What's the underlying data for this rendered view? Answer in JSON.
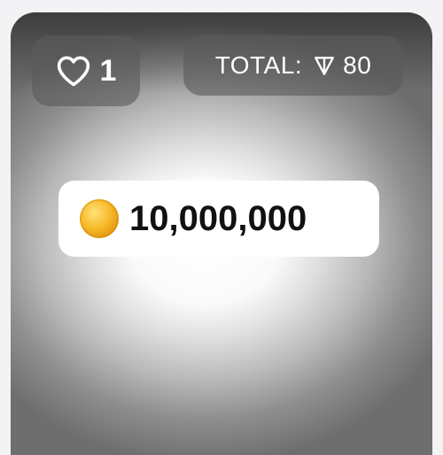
{
  "stats": {
    "likes_count": "1",
    "total_label": "TOTAL:",
    "total_value": "80",
    "currency_icon": "ton-icon"
  },
  "balance": {
    "amount": "10,000,000",
    "icon": "gold-coin-icon"
  }
}
